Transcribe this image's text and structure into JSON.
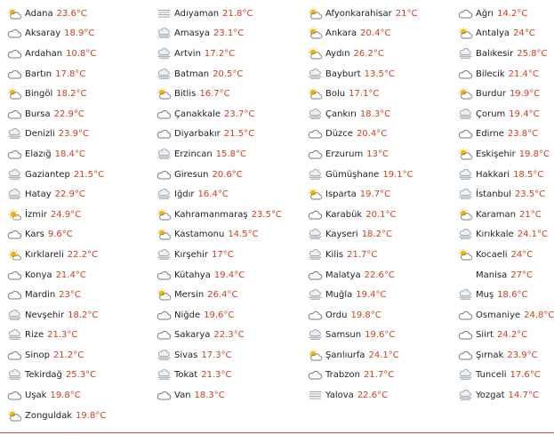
{
  "weather_list": [
    {
      "city": "Adana",
      "temp": "23.6°C",
      "icon": "partly-sunny-icon"
    },
    {
      "city": "Adıyaman",
      "temp": "21.8°C",
      "icon": "fog-icon"
    },
    {
      "city": "Afyonkarahisar",
      "temp": "21°C",
      "icon": "partly-sunny-icon"
    },
    {
      "city": "Ağrı",
      "temp": "14.2°C",
      "icon": "cloud-icon"
    },
    {
      "city": "Aksaray",
      "temp": "18.9°C",
      "icon": "cloud-icon"
    },
    {
      "city": "Amasya",
      "temp": "23.1°C",
      "icon": "mist-icon"
    },
    {
      "city": "Ankara",
      "temp": "20.4°C",
      "icon": "partly-sunny-icon"
    },
    {
      "city": "Antalya",
      "temp": "24°C",
      "icon": "partly-sunny-icon"
    },
    {
      "city": "Ardahan",
      "temp": "10.8°C",
      "icon": "cloud-icon"
    },
    {
      "city": "Artvin",
      "temp": "17.2°C",
      "icon": "mist-icon"
    },
    {
      "city": "Aydın",
      "temp": "26.2°C",
      "icon": "partly-sunny-icon"
    },
    {
      "city": "Balıkesir",
      "temp": "25.8°C",
      "icon": "mist-icon"
    },
    {
      "city": "Bartın",
      "temp": "17.8°C",
      "icon": "cloud-icon"
    },
    {
      "city": "Batman",
      "temp": "20.5°C",
      "icon": "mist-icon"
    },
    {
      "city": "Bayburt",
      "temp": "13.5°C",
      "icon": "mist-icon"
    },
    {
      "city": "Bilecik",
      "temp": "21.4°C",
      "icon": "cloud-icon"
    },
    {
      "city": "Bingöl",
      "temp": "18.2°C",
      "icon": "partly-sunny-icon"
    },
    {
      "city": "Bitlis",
      "temp": "16.7°C",
      "icon": "partly-sunny-icon"
    },
    {
      "city": "Bolu",
      "temp": "17.1°C",
      "icon": "partly-sunny-icon"
    },
    {
      "city": "Burdur",
      "temp": "19.9°C",
      "icon": "partly-sunny-icon"
    },
    {
      "city": "Bursa",
      "temp": "22.9°C",
      "icon": "cloud-icon"
    },
    {
      "city": "Çanakkale",
      "temp": "23.7°C",
      "icon": "cloud-icon"
    },
    {
      "city": "Çankırı",
      "temp": "18.3°C",
      "icon": "mist-icon"
    },
    {
      "city": "Çorum",
      "temp": "19.4°C",
      "icon": "mist-icon"
    },
    {
      "city": "Denizli",
      "temp": "23.9°C",
      "icon": "mist-icon"
    },
    {
      "city": "Diyarbakır",
      "temp": "21.5°C",
      "icon": "cloud-icon"
    },
    {
      "city": "Düzce",
      "temp": "20.4°C",
      "icon": "cloud-icon"
    },
    {
      "city": "Edirne",
      "temp": "23.8°C",
      "icon": "cloud-icon"
    },
    {
      "city": "Elazığ",
      "temp": "18.4°C",
      "icon": "cloud-icon"
    },
    {
      "city": "Erzincan",
      "temp": "15.8°C",
      "icon": "mist-icon"
    },
    {
      "city": "Erzurum",
      "temp": "13°C",
      "icon": "cloud-icon"
    },
    {
      "city": "Eskişehir",
      "temp": "19.8°C",
      "icon": "partly-sunny-icon"
    },
    {
      "city": "Gaziantep",
      "temp": "21.5°C",
      "icon": "mist-icon"
    },
    {
      "city": "Giresun",
      "temp": "20.6°C",
      "icon": "cloud-icon"
    },
    {
      "city": "Gümüşhane",
      "temp": "19.1°C",
      "icon": "mist-icon"
    },
    {
      "city": "Hakkari",
      "temp": "18.5°C",
      "icon": "mist-icon"
    },
    {
      "city": "Hatay",
      "temp": "22.9°C",
      "icon": "mist-icon"
    },
    {
      "city": "Iğdır",
      "temp": "16.4°C",
      "icon": "mist-icon"
    },
    {
      "city": "Isparta",
      "temp": "19.7°C",
      "icon": "partly-sunny-icon"
    },
    {
      "city": "İstanbul",
      "temp": "23.5°C",
      "icon": "mist-icon"
    },
    {
      "city": "İzmir",
      "temp": "24.9°C",
      "icon": "sunny-icon"
    },
    {
      "city": "Kahramanmaraş",
      "temp": "23.5°C",
      "icon": "partly-sunny-icon"
    },
    {
      "city": "Karabük",
      "temp": "20.1°C",
      "icon": "cloud-icon"
    },
    {
      "city": "Karaman",
      "temp": "21°C",
      "icon": "partly-sunny-icon"
    },
    {
      "city": "Kars",
      "temp": "9.6°C",
      "icon": "cloud-icon"
    },
    {
      "city": "Kastamonu",
      "temp": "14.5°C",
      "icon": "partly-sunny-icon"
    },
    {
      "city": "Kayseri",
      "temp": "18.2°C",
      "icon": "mist-icon"
    },
    {
      "city": "Kırıkkale",
      "temp": "24.1°C",
      "icon": "mist-icon"
    },
    {
      "city": "Kırklareli",
      "temp": "22.2°C",
      "icon": "sunny-icon"
    },
    {
      "city": "Kırşehir",
      "temp": "17°C",
      "icon": "mist-icon"
    },
    {
      "city": "Kilis",
      "temp": "21.7°C",
      "icon": "mist-icon"
    },
    {
      "city": "Kocaeli",
      "temp": "24°C",
      "icon": "partly-sunny-icon"
    },
    {
      "city": "Konya",
      "temp": "21.4°C",
      "icon": "cloud-icon"
    },
    {
      "city": "Kütahya",
      "temp": "19.4°C",
      "icon": "cloud-icon"
    },
    {
      "city": "Malatya",
      "temp": "22.6°C",
      "icon": "cloud-icon"
    },
    {
      "city": "Manisa",
      "temp": "27°C",
      "icon": ""
    },
    {
      "city": "Mardin",
      "temp": "23°C",
      "icon": "cloud-icon"
    },
    {
      "city": "Mersin",
      "temp": "26.4°C",
      "icon": "partly-sunny-icon"
    },
    {
      "city": "Muğla",
      "temp": "19.4°C",
      "icon": "mist-icon"
    },
    {
      "city": "Muş",
      "temp": "18.6°C",
      "icon": "mist-icon"
    },
    {
      "city": "Nevşehir",
      "temp": "18.2°C",
      "icon": "mist-icon"
    },
    {
      "city": "Niğde",
      "temp": "19.6°C",
      "icon": "cloud-icon"
    },
    {
      "city": "Ordu",
      "temp": "19.8°C",
      "icon": "cloud-icon"
    },
    {
      "city": "Osmaniye",
      "temp": "24.8°C",
      "icon": "cloud-icon"
    },
    {
      "city": "Rize",
      "temp": "21.3°C",
      "icon": "mist-icon"
    },
    {
      "city": "Sakarya",
      "temp": "22.3°C",
      "icon": "cloud-icon"
    },
    {
      "city": "Samsun",
      "temp": "19.6°C",
      "icon": "mist-icon"
    },
    {
      "city": "Siirt",
      "temp": "24.2°C",
      "icon": "cloud-icon"
    },
    {
      "city": "Sinop",
      "temp": "21.2°C",
      "icon": "cloud-icon"
    },
    {
      "city": "Sivas",
      "temp": "17.3°C",
      "icon": "mist-icon"
    },
    {
      "city": "Şanlıurfa",
      "temp": "24.1°C",
      "icon": "partly-sunny-icon"
    },
    {
      "city": "Şırnak",
      "temp": "23.9°C",
      "icon": "cloud-icon"
    },
    {
      "city": "Tekirdağ",
      "temp": "25.3°C",
      "icon": "mist-icon"
    },
    {
      "city": "Tokat",
      "temp": "21.3°C",
      "icon": "mist-icon"
    },
    {
      "city": "Trabzon",
      "temp": "21.7°C",
      "icon": "cloud-icon"
    },
    {
      "city": "Tunceli",
      "temp": "17.6°C",
      "icon": "mist-icon"
    },
    {
      "city": "Uşak",
      "temp": "19.8°C",
      "icon": "cloud-icon"
    },
    {
      "city": "Van",
      "temp": "18.3°C",
      "icon": "cloud-icon"
    },
    {
      "city": "Yalova",
      "temp": "22.6°C",
      "icon": "fog-icon"
    },
    {
      "city": "Yozgat",
      "temp": "14.7°C",
      "icon": "mist-icon"
    },
    {
      "city": "Zonguldak",
      "temp": "19.8°C",
      "icon": "partly-sunny-icon"
    }
  ],
  "colors": {
    "temperature": "#d33c1c",
    "city": "#222222",
    "bottom_line": "#d94a3a",
    "sun": "#f5b400",
    "cloud_outline": "#6f7a86",
    "mist": "#8c96a3"
  }
}
